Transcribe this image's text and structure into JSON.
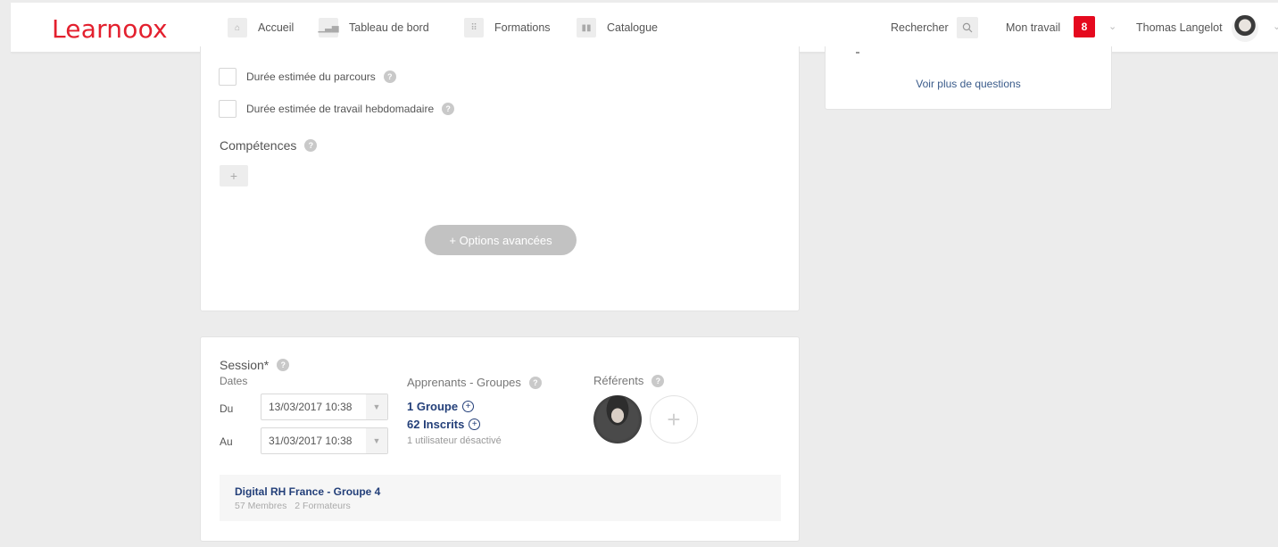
{
  "header": {
    "logo": "Learnoox",
    "nav": [
      {
        "label": "Accueil",
        "icon": "home-icon"
      },
      {
        "label": "Tableau de bord",
        "icon": "bar-chart-icon"
      },
      {
        "label": "Formations",
        "icon": "grid-icon"
      },
      {
        "label": "Catalogue",
        "icon": "book-icon"
      }
    ],
    "search_label": "Rechercher",
    "work_label": "Mon travail",
    "work_count": "8",
    "user_name": "Thomas Langelot",
    "accent_color": "#e5091e"
  },
  "options": {
    "duration_label": "Durée estimée du parcours",
    "weekly_label": "Durée estimée de travail hebdomadaire",
    "skills_title": "Compétences",
    "advanced_button": "+ Options avancées"
  },
  "side": {
    "more_questions": "Voir plus de questions"
  },
  "session": {
    "title": "Session*",
    "dates_label": "Dates",
    "from_label": "Du",
    "from_value": "13/03/2017 10:38",
    "to_label": "Au",
    "to_value": "31/03/2017 10:38",
    "learners_label": "Apprenants - Groupes",
    "groups_count": "1 Groupe",
    "enrolled_count": "62 Inscrits",
    "disabled_users": "1 utilisateur désactivé",
    "referents_label": "Référents",
    "group": {
      "name": "Digital RH France - Groupe 4",
      "members": "57 Membres",
      "trainers": "2 Formateurs"
    }
  }
}
